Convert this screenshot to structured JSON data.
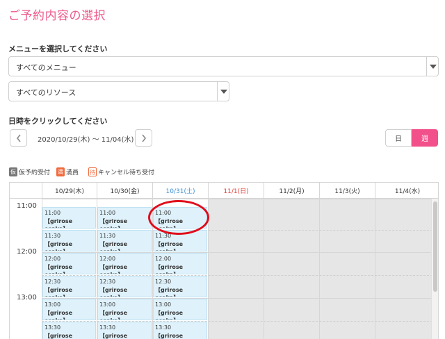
{
  "page_title": "ご予約内容の選択",
  "menu_section": {
    "label": "メニューを選択してください",
    "menu_select": "すべてのメニュー",
    "resource_select": "すべてのリソース"
  },
  "date_section": {
    "label": "日時をクリックしてください",
    "range": "2020/10/29(木) ～ 11/04(水)",
    "toggle_day": "日",
    "toggle_week": "週"
  },
  "legend": [
    {
      "mark": "仮",
      "label": "仮予約受付",
      "color": "#777777"
    },
    {
      "mark": "満",
      "label": "満員",
      "color": "#f06a3d"
    },
    {
      "mark": "待",
      "label": "キャンセル待ち受付",
      "color": "#f06a3d"
    }
  ],
  "calendar": {
    "days": [
      {
        "label": "10/29(木)",
        "color": "#333333",
        "available": true
      },
      {
        "label": "10/30(金)",
        "color": "#333333",
        "available": true
      },
      {
        "label": "10/31(土)",
        "color": "#3a8fd0",
        "available": true
      },
      {
        "label": "11/1(日)",
        "color": "#e0403a",
        "available": false
      },
      {
        "label": "11/2(月)",
        "color": "#333333",
        "available": false
      },
      {
        "label": "11/3(火)",
        "color": "#333333",
        "available": false
      },
      {
        "label": "11/4(水)",
        "color": "#333333",
        "available": false
      }
    ],
    "hours": [
      "11:00",
      "12:00",
      "13:00"
    ],
    "slots": [
      {
        "time": "11:00",
        "name": "【grirose osaka】"
      },
      {
        "time": "11:30",
        "name": "【grirose osaka】"
      },
      {
        "time": "12:00",
        "name": "【grirose osaka】"
      },
      {
        "time": "12:30",
        "name": "【grirose osaka】"
      },
      {
        "time": "13:00",
        "name": "【grirose osaka】"
      },
      {
        "time": "13:30",
        "name": "【grirose osaka】"
      }
    ]
  }
}
